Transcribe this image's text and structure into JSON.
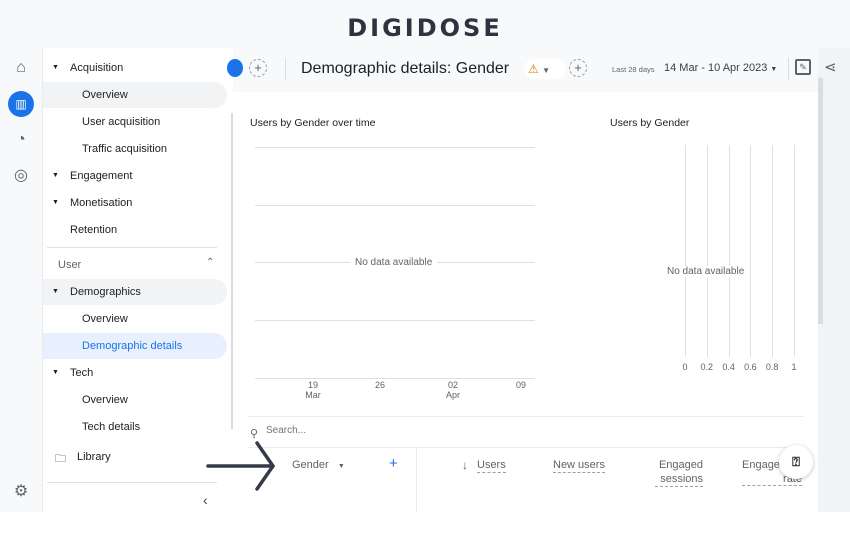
{
  "logo": "DIGIDOSE",
  "nav": {
    "items": [
      {
        "label": "Acquisition",
        "level": 0,
        "arrow": true
      },
      {
        "label": "Overview",
        "level": 1
      },
      {
        "label": "User acquisition",
        "level": 1
      },
      {
        "label": "Traffic acquisition",
        "level": 1
      },
      {
        "label": "Engagement",
        "level": 0,
        "arrow": true
      },
      {
        "label": "Monetisation",
        "level": 0,
        "arrow": true
      },
      {
        "label": "Retention",
        "level": 0
      }
    ],
    "section": "User",
    "items2": [
      {
        "label": "Demographics",
        "level": 0,
        "arrow": true
      },
      {
        "label": "Overview",
        "level": 1
      },
      {
        "label": "Demographic details",
        "level": 1,
        "selected": true
      },
      {
        "label": "Tech",
        "level": 0,
        "arrow": true
      },
      {
        "label": "Overview",
        "level": 1
      },
      {
        "label": "Tech details",
        "level": 1
      }
    ],
    "library": "Library"
  },
  "header": {
    "title": "Demographic details: Gender",
    "range_label": "Last 28 days",
    "date_range": "14 Mar - 10 Apr 2023"
  },
  "line_chart": {
    "title": "Users by Gender over time",
    "empty": "No data available",
    "x_ticks": [
      [
        "19",
        "Mar"
      ],
      [
        "26",
        ""
      ],
      [
        "02",
        "Apr"
      ],
      [
        "09",
        ""
      ]
    ]
  },
  "bar_chart": {
    "title": "Users by Gender",
    "empty": "No data available",
    "x_ticks": [
      "0",
      "0.2",
      "0.4",
      "0.6",
      "0.8",
      "1"
    ]
  },
  "table": {
    "search_placeholder": "Search...",
    "dimension": "Gender",
    "columns": [
      "Users",
      "New users",
      "Engaged sessions",
      "Engagement rate"
    ]
  },
  "colors": {
    "accent": "#1a73e8",
    "warning": "#e37400"
  }
}
